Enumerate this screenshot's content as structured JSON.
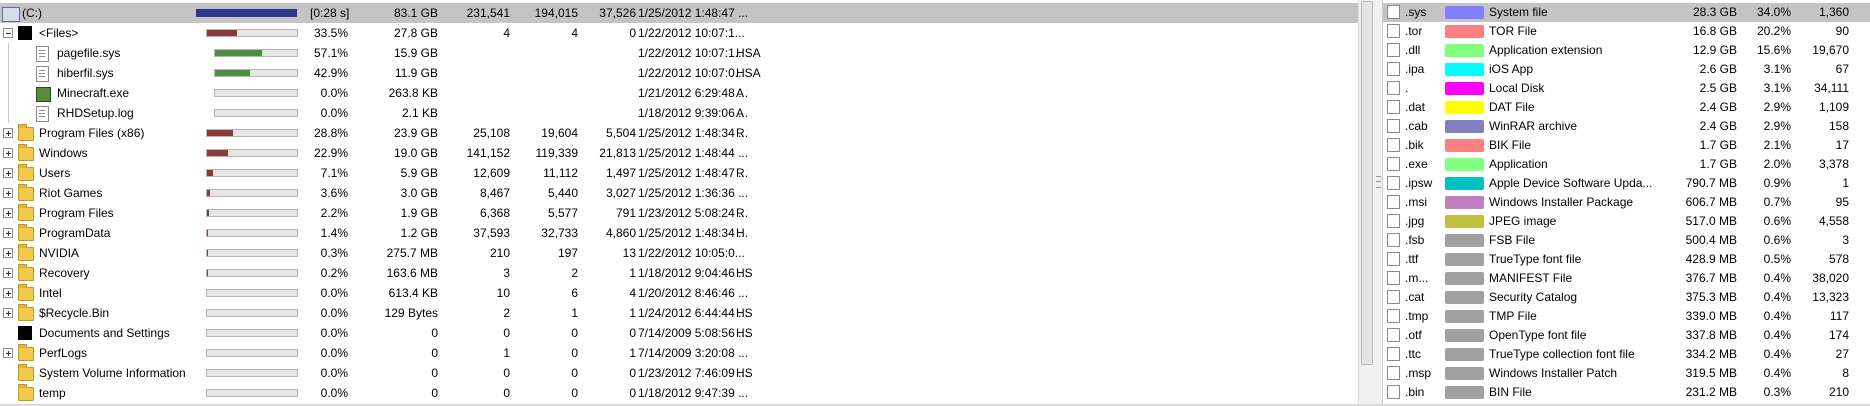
{
  "tree": {
    "root": {
      "name": "(C:)",
      "time": "[0:28 s]",
      "size": "83.1 GB",
      "items": "231,541",
      "files": "194,015",
      "subdirs": "37,526",
      "modified": "1/25/2012 1:48:47 ...",
      "attr": "",
      "bar_fraction": 1.0
    },
    "rows": [
      {
        "name": "<Files>",
        "icon": "black-box-icon",
        "expander": "minus",
        "percent": "33.5%",
        "bar_fraction": 0.335,
        "bar_color": "#8b3a3a",
        "size": "27.8 GB",
        "items": "4",
        "files": "4",
        "subdirs": "0",
        "modified": "1/22/2012 10:07:1...",
        "attr": ""
      },
      {
        "name": "pagefile.sys",
        "icon": "system-file-icon",
        "child": true,
        "percent": "57.1%",
        "bar_fraction": 0.571,
        "bar_color": "#4a8f3f",
        "size": "15.9 GB",
        "items": "",
        "files": "",
        "subdirs": "",
        "modified": "1/22/2012 10:07:1...",
        "attr": "HSA"
      },
      {
        "name": "hiberfil.sys",
        "icon": "system-file-icon",
        "child": true,
        "percent": "42.9%",
        "bar_fraction": 0.429,
        "bar_color": "#4a8f3f",
        "size": "11.9 GB",
        "items": "",
        "files": "",
        "subdirs": "",
        "modified": "1/22/2012 10:07:0...",
        "attr": "HSA"
      },
      {
        "name": "Minecraft.exe",
        "icon": "minecraft-icon",
        "child": true,
        "percent": "0.0%",
        "bar_fraction": 0.0,
        "bar_color": "#4a8f3f",
        "size": "263.8 KB",
        "items": "",
        "files": "",
        "subdirs": "",
        "modified": "1/21/2012 6:29:48 ...",
        "attr": "A"
      },
      {
        "name": "RHDSetup.log",
        "icon": "text-file-icon",
        "child": true,
        "percent": "0.0%",
        "bar_fraction": 0.0,
        "bar_color": "#4a8f3f",
        "size": "2.1 KB",
        "items": "",
        "files": "",
        "subdirs": "",
        "modified": "1/18/2012 9:39:06 ...",
        "attr": "A"
      },
      {
        "name": "Program Files (x86)",
        "icon": "folder-icon",
        "expander": "plus",
        "percent": "28.8%",
        "bar_fraction": 0.288,
        "bar_color": "#8b3a3a",
        "size": "23.9 GB",
        "items": "25,108",
        "files": "19,604",
        "subdirs": "5,504",
        "modified": "1/25/2012 1:48:34 ...",
        "attr": "R"
      },
      {
        "name": "Windows",
        "icon": "folder-icon",
        "expander": "plus",
        "percent": "22.9%",
        "bar_fraction": 0.229,
        "bar_color": "#8b3a3a",
        "size": "19.0 GB",
        "items": "141,152",
        "files": "119,339",
        "subdirs": "21,813",
        "modified": "1/25/2012 1:48:44 ...",
        "attr": ""
      },
      {
        "name": "Users",
        "icon": "folder-icon",
        "expander": "plus",
        "percent": "7.1%",
        "bar_fraction": 0.071,
        "bar_color": "#8b3a3a",
        "size": "5.9 GB",
        "items": "12,609",
        "files": "11,112",
        "subdirs": "1,497",
        "modified": "1/25/2012 1:48:47 ...",
        "attr": "R"
      },
      {
        "name": "Riot Games",
        "icon": "folder-icon",
        "expander": "plus",
        "percent": "3.6%",
        "bar_fraction": 0.036,
        "bar_color": "#8b3a3a",
        "size": "3.0 GB",
        "items": "8,467",
        "files": "5,440",
        "subdirs": "3,027",
        "modified": "1/25/2012 1:36:36 ...",
        "attr": ""
      },
      {
        "name": "Program Files",
        "icon": "folder-icon",
        "expander": "plus",
        "percent": "2.2%",
        "bar_fraction": 0.022,
        "bar_color": "#8b3a3a",
        "size": "1.9 GB",
        "items": "6,368",
        "files": "5,577",
        "subdirs": "791",
        "modified": "1/23/2012 5:08:24 ...",
        "attr": "R"
      },
      {
        "name": "ProgramData",
        "icon": "folder-icon",
        "expander": "plus",
        "percent": "1.4%",
        "bar_fraction": 0.014,
        "bar_color": "#8b3a3a",
        "size": "1.2 GB",
        "items": "37,593",
        "files": "32,733",
        "subdirs": "4,860",
        "modified": "1/25/2012 1:48:34 ...",
        "attr": "H"
      },
      {
        "name": "NVIDIA",
        "icon": "folder-icon",
        "expander": "plus",
        "percent": "0.3%",
        "bar_fraction": 0.003,
        "bar_color": "#8b3a3a",
        "size": "275.7 MB",
        "items": "210",
        "files": "197",
        "subdirs": "13",
        "modified": "1/22/2012 10:05:0...",
        "attr": ""
      },
      {
        "name": "Recovery",
        "icon": "folder-icon",
        "expander": "plus",
        "percent": "0.2%",
        "bar_fraction": 0.002,
        "bar_color": "#8b3a3a",
        "size": "163.6 MB",
        "items": "3",
        "files": "2",
        "subdirs": "1",
        "modified": "1/18/2012 9:04:46 ...",
        "attr": "HS"
      },
      {
        "name": "Intel",
        "icon": "folder-icon",
        "expander": "plus",
        "percent": "0.0%",
        "bar_fraction": 0.0,
        "bar_color": "#8b3a3a",
        "size": "613.4 KB",
        "items": "10",
        "files": "6",
        "subdirs": "4",
        "modified": "1/20/2012 8:46:46 ...",
        "attr": ""
      },
      {
        "name": "$Recycle.Bin",
        "icon": "folder-icon",
        "expander": "plus",
        "percent": "0.0%",
        "bar_fraction": 0.0,
        "bar_color": "#8b3a3a",
        "size": "129 Bytes",
        "items": "2",
        "files": "1",
        "subdirs": "1",
        "modified": "1/24/2012 6:44:44 ...",
        "attr": "HS"
      },
      {
        "name": "Documents and Settings",
        "icon": "black-box-icon",
        "percent": "0.0%",
        "bar_fraction": 0.0,
        "bar_color": "#8b3a3a",
        "size": "0",
        "items": "0",
        "files": "0",
        "subdirs": "0",
        "modified": "7/14/2009 5:08:56 ...",
        "attr": "HS"
      },
      {
        "name": "PerfLogs",
        "icon": "folder-icon",
        "expander": "plus",
        "percent": "0.0%",
        "bar_fraction": 0.0,
        "bar_color": "#8b3a3a",
        "size": "0",
        "items": "1",
        "files": "0",
        "subdirs": "1",
        "modified": "7/14/2009 3:20:08 ...",
        "attr": ""
      },
      {
        "name": "System Volume Information",
        "icon": "folder-icon",
        "percent": "0.0%",
        "bar_fraction": 0.0,
        "bar_color": "#8b3a3a",
        "size": "0",
        "items": "0",
        "files": "0",
        "subdirs": "0",
        "modified": "1/23/2012 7:46:09 ...",
        "attr": "HS"
      },
      {
        "name": "temp",
        "icon": "folder-icon",
        "percent": "0.0%",
        "bar_fraction": 0.0,
        "bar_color": "#8b3a3a",
        "size": "0",
        "items": "0",
        "files": "0",
        "subdirs": "0",
        "modified": "1/18/2012 9:47:39 ...",
        "attr": ""
      }
    ]
  },
  "extensions": [
    {
      "ext": ".sys",
      "color": "#8080ff",
      "desc": "System file",
      "size": "28.3 GB",
      "percent": "34.0%",
      "files": "1,360",
      "selected": true
    },
    {
      "ext": ".tor",
      "color": "#ff8080",
      "desc": "TOR File",
      "size": "16.8 GB",
      "percent": "20.2%",
      "files": "90"
    },
    {
      "ext": ".dll",
      "color": "#80ff80",
      "desc": "Application extension",
      "size": "12.9 GB",
      "percent": "15.6%",
      "files": "19,670"
    },
    {
      "ext": ".ipa",
      "color": "#00ffff",
      "desc": "iOS App",
      "size": "2.6 GB",
      "percent": "3.1%",
      "files": "67"
    },
    {
      "ext": ".",
      "color": "#ff00ff",
      "desc": "Local Disk",
      "size": "2.5 GB",
      "percent": "3.1%",
      "files": "34,111"
    },
    {
      "ext": ".dat",
      "color": "#ffff00",
      "desc": "DAT File",
      "size": "2.4 GB",
      "percent": "2.9%",
      "files": "1,109"
    },
    {
      "ext": ".cab",
      "color": "#8080c0",
      "desc": "WinRAR archive",
      "size": "2.4 GB",
      "percent": "2.9%",
      "files": "158"
    },
    {
      "ext": ".bik",
      "color": "#ff8080",
      "desc": "BIK File",
      "size": "1.7 GB",
      "percent": "2.1%",
      "files": "17"
    },
    {
      "ext": ".exe",
      "color": "#80ff80",
      "desc": "Application",
      "size": "1.7 GB",
      "percent": "2.0%",
      "files": "3,378"
    },
    {
      "ext": ".ipsw",
      "color": "#00c0c0",
      "desc": "Apple Device Software Upda...",
      "size": "790.7 MB",
      "percent": "0.9%",
      "files": "1"
    },
    {
      "ext": ".msi",
      "color": "#c080c0",
      "desc": "Windows Installer Package",
      "size": "606.7 MB",
      "percent": "0.7%",
      "files": "95"
    },
    {
      "ext": ".jpg",
      "color": "#c0c040",
      "desc": "JPEG image",
      "size": "517.0 MB",
      "percent": "0.6%",
      "files": "4,558"
    },
    {
      "ext": ".fsb",
      "color": "#a0a0a0",
      "desc": "FSB File",
      "size": "500.4 MB",
      "percent": "0.6%",
      "files": "3"
    },
    {
      "ext": ".ttf",
      "color": "#a0a0a0",
      "desc": "TrueType font file",
      "size": "428.9 MB",
      "percent": "0.5%",
      "files": "578"
    },
    {
      "ext": ".m...",
      "color": "#a0a0a0",
      "desc": "MANIFEST File",
      "size": "376.7 MB",
      "percent": "0.4%",
      "files": "38,020"
    },
    {
      "ext": ".cat",
      "color": "#a0a0a0",
      "desc": "Security Catalog",
      "size": "375.3 MB",
      "percent": "0.4%",
      "files": "13,323"
    },
    {
      "ext": ".tmp",
      "color": "#a0a0a0",
      "desc": "TMP File",
      "size": "339.0 MB",
      "percent": "0.4%",
      "files": "117"
    },
    {
      "ext": ".otf",
      "color": "#a0a0a0",
      "desc": "OpenType font file",
      "size": "337.8 MB",
      "percent": "0.4%",
      "files": "174"
    },
    {
      "ext": ".ttc",
      "color": "#a0a0a0",
      "desc": "TrueType collection font file",
      "size": "334.2 MB",
      "percent": "0.4%",
      "files": "27"
    },
    {
      "ext": ".msp",
      "color": "#a0a0a0",
      "desc": "Windows Installer Patch",
      "size": "319.5 MB",
      "percent": "0.4%",
      "files": "8"
    },
    {
      "ext": ".bin",
      "color": "#a0a0a0",
      "desc": "BIN File",
      "size": "231.2 MB",
      "percent": "0.3%",
      "files": "210"
    }
  ],
  "colors": {
    "root_bar": "#30388a",
    "selection": "#c4c4c4"
  }
}
